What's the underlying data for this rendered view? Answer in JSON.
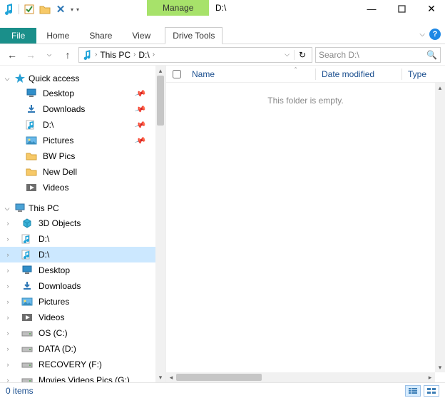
{
  "window": {
    "title": "D:\\",
    "context_tab": "Manage",
    "context_tool": "Drive Tools"
  },
  "ribbon_tabs": {
    "file": "File",
    "home": "Home",
    "share": "Share",
    "view": "View"
  },
  "nav": {
    "breadcrumb": {
      "root": "This PC",
      "current": "D:\\"
    },
    "search_placeholder": "Search D:\\"
  },
  "tree": {
    "quick_access": {
      "label": "Quick access",
      "items": [
        {
          "label": "Desktop",
          "icon": "desktop-icon",
          "pinned": true
        },
        {
          "label": "Downloads",
          "icon": "downloads-icon",
          "pinned": true
        },
        {
          "label": "D:\\",
          "icon": "music-drive-icon",
          "pinned": true
        },
        {
          "label": "Pictures",
          "icon": "pictures-icon",
          "pinned": true
        },
        {
          "label": "BW Pics",
          "icon": "folder-icon",
          "pinned": false
        },
        {
          "label": "New Dell",
          "icon": "folder-icon",
          "pinned": false
        },
        {
          "label": "Videos",
          "icon": "videos-icon",
          "pinned": false
        }
      ]
    },
    "this_pc": {
      "label": "This PC",
      "items": [
        {
          "label": "3D Objects",
          "icon": "3d-objects-icon"
        },
        {
          "label": "D:\\",
          "icon": "music-drive-icon"
        },
        {
          "label": "D:\\",
          "icon": "music-drive-icon",
          "selected": true
        },
        {
          "label": "Desktop",
          "icon": "desktop-icon"
        },
        {
          "label": "Downloads",
          "icon": "downloads-icon"
        },
        {
          "label": "Pictures",
          "icon": "pictures-icon"
        },
        {
          "label": "Videos",
          "icon": "videos-icon"
        },
        {
          "label": "OS (C:)",
          "icon": "drive-icon"
        },
        {
          "label": "DATA (D:)",
          "icon": "drive-icon"
        },
        {
          "label": "RECOVERY (F:)",
          "icon": "drive-icon"
        },
        {
          "label": "Movies Videos Pics (G:)",
          "icon": "drive-icon"
        }
      ]
    }
  },
  "columns": {
    "name": "Name",
    "date": "Date modified",
    "type": "Type"
  },
  "content": {
    "empty_message": "This folder is empty."
  },
  "status": {
    "count": "0 items"
  },
  "help_glyph": "?"
}
